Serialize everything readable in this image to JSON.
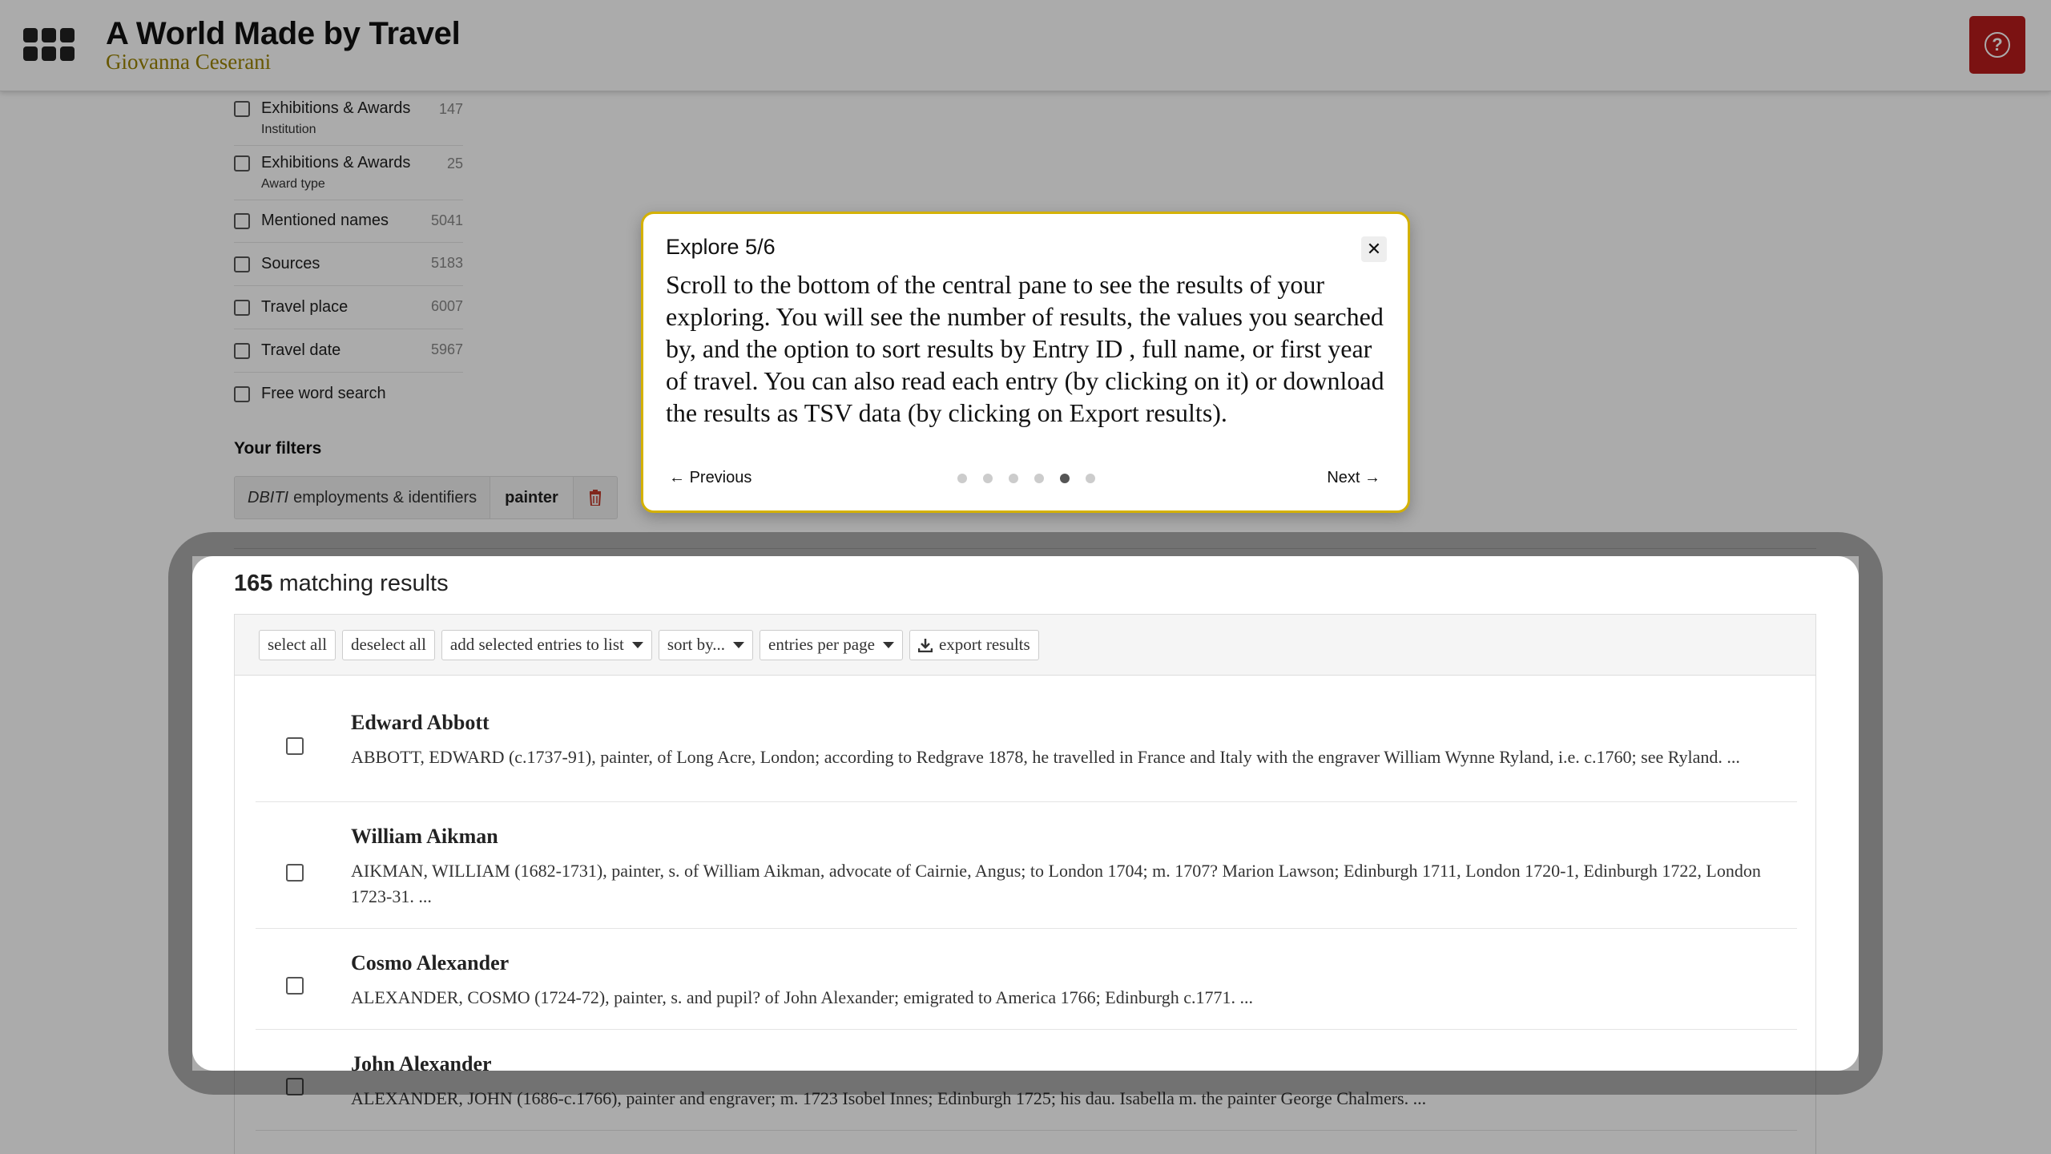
{
  "header": {
    "title": "A World Made by Travel",
    "subtitle": "Giovanna Ceserani",
    "help_icon": "question-circle-icon",
    "apps_icon": "grid-icon"
  },
  "filters": [
    {
      "label": "Exhibitions & Awards",
      "sub": "Institution",
      "count": "147"
    },
    {
      "label": "Exhibitions & Awards",
      "sub": "Award type",
      "count": "25"
    },
    {
      "label": "Mentioned names",
      "sub": "",
      "count": "5041"
    },
    {
      "label": "Sources",
      "sub": "",
      "count": "5183"
    },
    {
      "label": "Travel place",
      "sub": "",
      "count": "6007"
    },
    {
      "label": "Travel date",
      "sub": "",
      "count": "5967"
    },
    {
      "label": "Free word search",
      "sub": "",
      "count": ""
    }
  ],
  "your_filters": {
    "title": "Your filters",
    "chip_field_italic": "DBITI",
    "chip_field_rest": "employments & identifiers",
    "chip_value": "painter",
    "delete_icon": "trash-icon"
  },
  "results": {
    "count": "165",
    "count_label": "matching results",
    "toolbar": {
      "select_all": "select all",
      "deselect_all": "deselect all",
      "add_to_list": "add selected entries to list",
      "sort_by": "sort by...",
      "entries_per_page": "entries per page",
      "export": "export results"
    },
    "entries": [
      {
        "name": "Edward Abbott",
        "desc": "ABBOTT, EDWARD (c.1737-91), painter, of Long Acre, London; according to Redgrave 1878, he travelled in France and Italy with the engraver William Wynne Ryland, i.e. c.1760; see Ryland. ..."
      },
      {
        "name": "William Aikman",
        "desc": "AIKMAN, WILLIAM (1682-1731), painter, s. of William Aikman, advocate of Cairnie, Angus; to London 1704; m. 1707? Marion Lawson; Edinburgh 1711, London 1720-1, Edinburgh 1722, London 1723-31. ..."
      },
      {
        "name": "Cosmo Alexander",
        "desc": "ALEXANDER, COSMO (1724-72), painter, s. and pupil? of John Alexander; emigrated to America 1766; Edinburgh c.1771. ..."
      },
      {
        "name": "John Alexander",
        "desc": "ALEXANDER, JOHN (1686-c.1766), painter and engraver; m. 1723 Isobel Innes; Edinburgh 1725; his dau. Isabella m. the painter George Chalmers. ..."
      }
    ]
  },
  "tour": {
    "title": "Explore 5/6",
    "body": "Scroll to the bottom of the central pane to see the results of your exploring. You will see the number of results, the values you searched by, and the option to sort results by Entry ID , full name, or first year of travel.  You can also read each entry (by clicking on it) or download the results as TSV data (by clicking on Export results).",
    "previous": "Previous",
    "next": "Next",
    "close_icon": "close-icon",
    "current_step": 5,
    "total_steps": 6
  }
}
